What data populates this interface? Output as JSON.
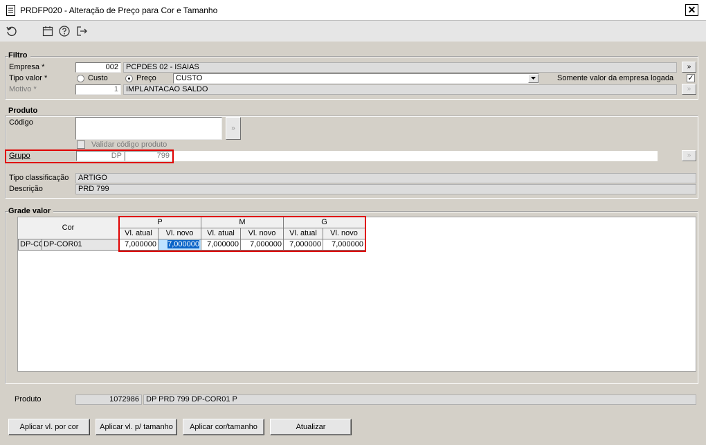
{
  "window": {
    "title": "PRDFP020 - Alteração de Preço para Cor e Tamanho",
    "close_label": "✕"
  },
  "toolbar": {
    "icons": [
      "refresh-icon",
      "calendar-icon",
      "help-icon",
      "exit-icon"
    ]
  },
  "filtro": {
    "title": "Filtro",
    "empresa_label": "Empresa *",
    "empresa_code": "002",
    "empresa_name": "PCPDES 02 - ISAIAS",
    "empresa_btn": "»",
    "tipo_valor_label": "Tipo valor *",
    "custo_label": "Custo",
    "preco_label": "Preço",
    "tipo_valor_value": "CUSTO",
    "somente_label": "Somente valor da empresa logada",
    "somente_checked": "✓",
    "motivo_label": "Motivo *",
    "motivo_code": "1",
    "motivo_name": "IMPLANTACAO SALDO",
    "motivo_btn": "»"
  },
  "produto": {
    "title": "Produto",
    "codigo_label": "Código",
    "codigo_btn": "»",
    "validar_label": "Validar código produto",
    "grupo_label": "Grupo",
    "grupo_prefix": "DP",
    "grupo_code": "799",
    "grupo_btn": "»",
    "tipo_class_label": "Tipo classificação",
    "tipo_class_value": "ARTIGO",
    "descricao_label": "Descrição",
    "descricao_value": "PRD 799"
  },
  "grade": {
    "title": "Grade valor",
    "cor_header": "Cor",
    "sizes": [
      "P",
      "M",
      "G"
    ],
    "sub_headers": [
      "Vl. atual",
      "Vl. novo",
      "Vl. atual",
      "Vl. novo",
      "Vl. atual",
      "Vl. novo"
    ],
    "rows": [
      {
        "cor_code": "DP-CO",
        "cor_name": "DP-COR01",
        "values": [
          "7,000000",
          "7,000000",
          "7,000000",
          "7,000000",
          "7,000000",
          "7,000000"
        ]
      }
    ]
  },
  "footer": {
    "produto_label": "Produto",
    "produto_code": "1072986",
    "produto_desc": "DP PRD 799 DP-COR01 P"
  },
  "buttons": {
    "aplicar_cor": "Aplicar vl. por cor",
    "aplicar_tamanho": "Aplicar vl. p/ tamanho",
    "aplicar_cor_tamanho": "Aplicar cor/tamanho",
    "atualizar": "Atualizar"
  }
}
